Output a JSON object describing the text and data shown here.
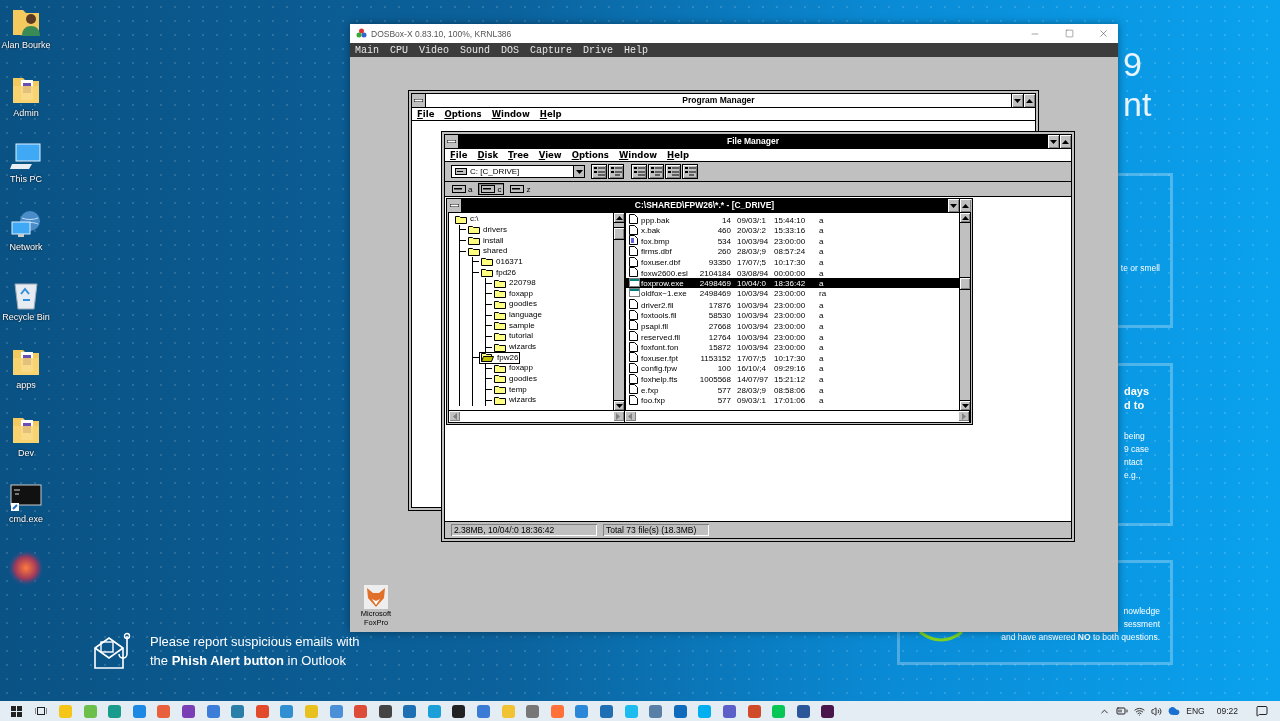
{
  "desktop_icons": [
    {
      "label": "Alan Bourke",
      "kind": "user-folder"
    },
    {
      "label": "Admin",
      "kind": "folder"
    },
    {
      "label": "This PC",
      "kind": "computer"
    },
    {
      "label": "Network",
      "kind": "network"
    },
    {
      "label": "Recycle Bin",
      "kind": "recycle-bin"
    },
    {
      "label": "apps",
      "kind": "folder"
    },
    {
      "label": "Dev",
      "kind": "folder"
    },
    {
      "label": "cmd.exe",
      "kind": "terminal"
    },
    {
      "kind": "orb"
    }
  ],
  "wallpaper": {
    "heading_lines": [
      "9",
      "nt"
    ],
    "cards": [
      {
        "lines": [
          "te or smell"
        ]
      },
      {
        "title_lines": [
          "days",
          "d to"
        ],
        "lines": [
          "being",
          "9 case",
          "ntact",
          "e.g.,"
        ]
      },
      {
        "lines": [
          "nowledge",
          "sessment",
          "and have answered **NO** to both questions."
        ]
      }
    ],
    "phish_notice": "Please report suspicious emails with the **Phish Alert button** in Outlook"
  },
  "dosbox": {
    "title": "DOSBox-X 0.83.10, 100%, KRNL386",
    "menu": [
      "Main",
      "CPU",
      "Video",
      "Sound",
      "DOS",
      "Capture",
      "Drive",
      "Help"
    ],
    "program_manager": {
      "title": "Program Manager",
      "menu": [
        "File",
        "Options",
        "Window",
        "Help"
      ]
    },
    "file_manager": {
      "title": "File Manager",
      "menu": [
        "File",
        "Disk",
        "Tree",
        "View",
        "Options",
        "Window",
        "Help"
      ],
      "drive_select": "C: [C_DRIVE]",
      "drives": [
        {
          "letter": "a",
          "selected": false
        },
        {
          "letter": "c",
          "selected": true
        },
        {
          "letter": "z",
          "selected": false
        }
      ],
      "directory_window": {
        "title": "C:\\SHARED\\FPW26\\*.* - [C_DRIVE]",
        "tree": {
          "label": "c:\\",
          "selected": false,
          "children": [
            {
              "label": "drivers",
              "selected": false
            },
            {
              "label": "install",
              "selected": false
            },
            {
              "label": "shared",
              "selected": false,
              "children": [
                {
                  "label": "016371",
                  "selected": false
                },
                {
                  "label": "fpd26",
                  "selected": false,
                  "children": [
                    {
                      "label": "220798",
                      "selected": false
                    },
                    {
                      "label": "foxapp",
                      "selected": false
                    },
                    {
                      "label": "goodies",
                      "selected": false
                    },
                    {
                      "label": "language",
                      "selected": false
                    },
                    {
                      "label": "sample",
                      "selected": false
                    },
                    {
                      "label": "tutorial",
                      "selected": false
                    },
                    {
                      "label": "wizards",
                      "selected": false
                    }
                  ]
                },
                {
                  "label": "fpw26",
                  "selected": true,
                  "children": [
                    {
                      "label": "foxapp",
                      "selected": false
                    },
                    {
                      "label": "goodies",
                      "selected": false
                    },
                    {
                      "label": "temp",
                      "selected": false
                    },
                    {
                      "label": "wizards",
                      "selected": false
                    }
                  ]
                }
              ]
            }
          ]
        },
        "files": [
          {
            "name": "ppp.bak",
            "size": "14",
            "date": "09/03/:1",
            "time": "15:44:10",
            "attributes": "a",
            "kind": "document",
            "selected": false
          },
          {
            "name": "x.bak",
            "size": "460",
            "date": "20/03/:2",
            "time": "15:33:16",
            "attributes": "a",
            "kind": "document",
            "selected": false
          },
          {
            "name": "fox.bmp",
            "size": "534",
            "date": "10/03/94",
            "time": "23:00:00",
            "attributes": "a",
            "kind": "image",
            "selected": false
          },
          {
            "name": "firms.dbf",
            "size": "260",
            "date": "28/03/;9",
            "time": "08:57:24",
            "attributes": "a",
            "kind": "document",
            "selected": false
          },
          {
            "name": "foxuser.dbf",
            "size": "93350",
            "date": "17/07/;5",
            "time": "10:17:30",
            "attributes": "a",
            "kind": "document",
            "selected": false
          },
          {
            "name": "foxw2600.esl",
            "size": "2104184",
            "date": "03/08/94",
            "time": "00:00:00",
            "attributes": "a",
            "kind": "document",
            "selected": false
          },
          {
            "name": "foxprow.exe",
            "size": "2498469",
            "date": "10/04/:0",
            "time": "18:36:42",
            "attributes": "a",
            "kind": "program",
            "selected": true
          },
          {
            "name": "oldfox~1.exe",
            "size": "2498469",
            "date": "10/03/94",
            "time": "23:00:00",
            "attributes": "ra",
            "kind": "program",
            "selected": false
          },
          {
            "name": "driver2.fll",
            "size": "17876",
            "date": "10/03/94",
            "time": "23:00:00",
            "attributes": "a",
            "kind": "document",
            "selected": false
          },
          {
            "name": "foxtools.fll",
            "size": "58530",
            "date": "10/03/94",
            "time": "23:00:00",
            "attributes": "a",
            "kind": "document",
            "selected": false
          },
          {
            "name": "psapi.fll",
            "size": "27668",
            "date": "10/03/94",
            "time": "23:00:00",
            "attributes": "a",
            "kind": "document",
            "selected": false
          },
          {
            "name": "reserved.fll",
            "size": "12764",
            "date": "10/03/94",
            "time": "23:00:00",
            "attributes": "a",
            "kind": "document",
            "selected": false
          },
          {
            "name": "foxfont.fon",
            "size": "15872",
            "date": "10/03/94",
            "time": "23:00:00",
            "attributes": "a",
            "kind": "document",
            "selected": false
          },
          {
            "name": "foxuser.fpt",
            "size": "1153152",
            "date": "17/07/;5",
            "time": "10:17:30",
            "attributes": "a",
            "kind": "document",
            "selected": false
          },
          {
            "name": "config.fpw",
            "size": "100",
            "date": "16/10/;4",
            "time": "09:29:16",
            "attributes": "a",
            "kind": "document",
            "selected": false
          },
          {
            "name": "foxhelp.fts",
            "size": "1005568",
            "date": "14/07/97",
            "time": "15:21:12",
            "attributes": "a",
            "kind": "document",
            "selected": false
          },
          {
            "name": "e.fxp",
            "size": "577",
            "date": "28/03/;9",
            "time": "08:58:06",
            "attributes": "a",
            "kind": "document",
            "selected": false
          },
          {
            "name": "foo.fxp",
            "size": "577",
            "date": "09/03/:1",
            "time": "17:01:06",
            "attributes": "a",
            "kind": "document",
            "selected": false
          }
        ]
      },
      "status_bar": [
        "2.38MB, 10/04/:0 18:36:42",
        "Total 73 file(s) (18.3MB)"
      ]
    },
    "minimized_app": {
      "label": "Microsoft FoxPro"
    }
  },
  "taskbar": {
    "apps": [
      {
        "color": "#f5c518"
      },
      {
        "color": "#6cbf4a"
      },
      {
        "color": "#1a9c8c"
      },
      {
        "color": "#1e88e5"
      },
      {
        "color": "#e8603c"
      },
      {
        "color": "#7b3fb5"
      },
      {
        "color": "#3b7dd8"
      },
      {
        "color": "#2a7fa8"
      },
      {
        "color": "#e24a2b"
      },
      {
        "color": "#2f8fd0"
      },
      {
        "color": "#e8c020"
      },
      {
        "color": "#4a8fd8"
      },
      {
        "color": "#dd4b39"
      },
      {
        "color": "#444444"
      },
      {
        "color": "#1f6fb5"
      },
      {
        "color": "#1a9fd8"
      },
      {
        "color": "#222222"
      },
      {
        "color": "#3a7bd5"
      },
      {
        "color": "#f1c232"
      },
      {
        "color": "#777777"
      },
      {
        "color": "#ff7139"
      },
      {
        "color": "#2b88d8"
      },
      {
        "color": "#1f6fb5"
      },
      {
        "color": "#1ebbee"
      },
      {
        "color": "#5a7fa6"
      },
      {
        "color": "#0f6cbd"
      },
      {
        "color": "#00aff0"
      },
      {
        "color": "#5b5fc7"
      },
      {
        "color": "#d04a2a"
      },
      {
        "color": "#06c755"
      },
      {
        "color": "#2b579a"
      },
      {
        "color": "#4a154b"
      }
    ],
    "language": "ENG",
    "clock": "09:22"
  }
}
